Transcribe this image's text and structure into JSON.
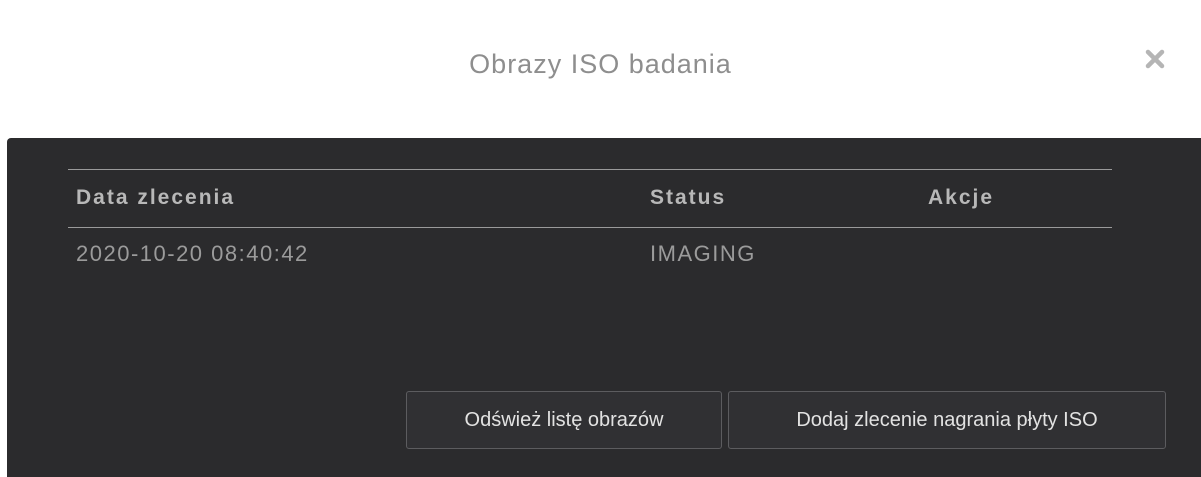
{
  "dialog": {
    "title": "Obrazy ISO badania",
    "close_icon": "close-icon"
  },
  "table": {
    "headers": {
      "date": "Data zlecenia",
      "status": "Status",
      "actions": "Akcje"
    },
    "rows": [
      {
        "date": "2020-10-20 08:40:42",
        "status": "IMAGING",
        "actions": ""
      }
    ]
  },
  "buttons": {
    "refresh_label": "Odśwież listę obrazów",
    "add_label": "Dodaj zlecenie nagrania płyty ISO"
  }
}
